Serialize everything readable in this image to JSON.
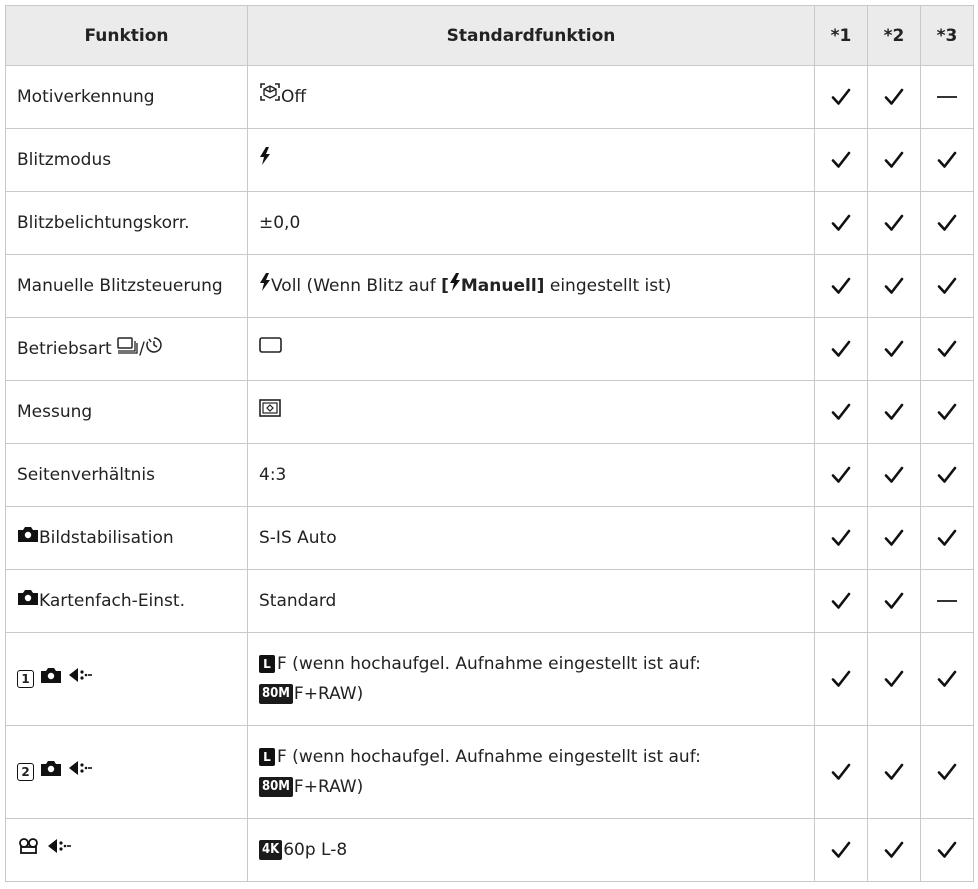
{
  "table": {
    "headers": [
      "Funktion",
      "Standardfunktion",
      "*1",
      "*2",
      "*3"
    ],
    "rows": [
      {
        "func": "Motiverkennung",
        "std": "Off",
        "c": [
          true,
          true,
          false
        ]
      },
      {
        "func": "Blitzmodus",
        "std": "",
        "c": [
          true,
          true,
          true
        ]
      },
      {
        "func": "Blitzbelichtungskorr.",
        "std": "±0,0",
        "c": [
          true,
          true,
          true
        ]
      },
      {
        "func": "Manuelle Blitzsteuerung",
        "std_a": "Voll (Wenn Blitz auf ",
        "std_b": "[",
        "std_c": "Manuell]",
        "std_d": " eingestellt ist)",
        "c": [
          true,
          true,
          true
        ]
      },
      {
        "func": "Betriebsart ",
        "func_b": "/",
        "std": "",
        "c": [
          true,
          true,
          true
        ]
      },
      {
        "func": "Messung",
        "std": "",
        "c": [
          true,
          true,
          true
        ]
      },
      {
        "func": "Seitenverhältnis",
        "std": "4:3",
        "c": [
          true,
          true,
          true
        ]
      },
      {
        "func": "Bildstabilisation",
        "std": "S-IS Auto",
        "c": [
          true,
          true,
          true
        ]
      },
      {
        "func": "Kartenfach-Einst.",
        "std": "Standard",
        "c": [
          true,
          true,
          false
        ]
      },
      {
        "func_num": "1",
        "std_badge": "L",
        "std_a": "F (wenn hochaufgel. Aufnahme eingestellt ist auf:",
        "std_badge2": "80M",
        "std_b": "F+RAW)",
        "c": [
          true,
          true,
          true
        ]
      },
      {
        "func_num": "2",
        "std_badge": "L",
        "std_a": "F (wenn hochaufgel. Aufnahme eingestellt ist auf:",
        "std_badge2": "80M",
        "std_b": "F+RAW)",
        "c": [
          true,
          true,
          true
        ]
      },
      {
        "std_badge": "4K",
        "std_a": "60p L-8",
        "c": [
          true,
          true,
          true
        ]
      }
    ]
  }
}
